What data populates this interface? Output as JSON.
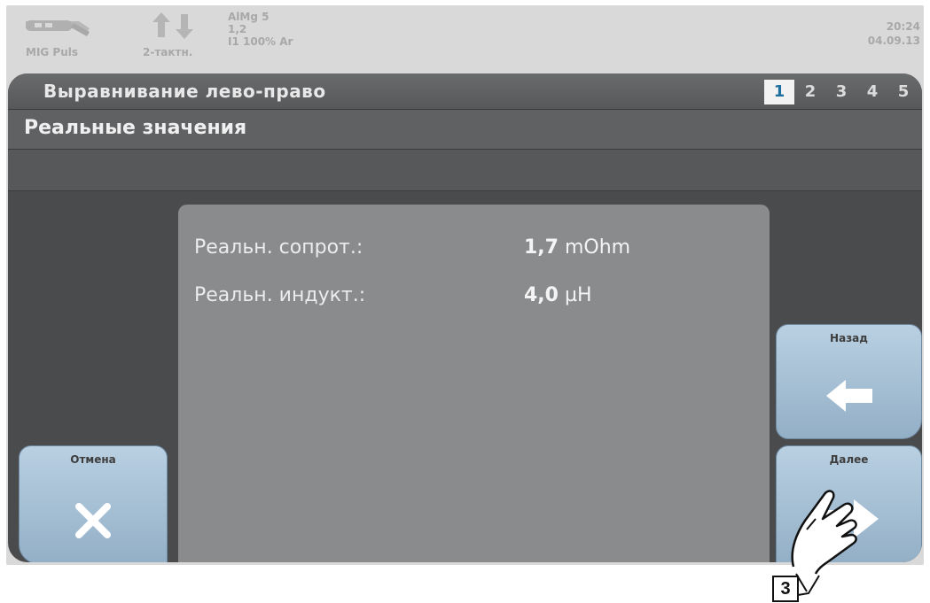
{
  "status_bar": {
    "mode_label": "MIG Puls",
    "trigger_label": "2-тактн.",
    "material_lines": [
      "AlMg 5",
      "1,2",
      "I1 100% Ar"
    ],
    "time": "20:24",
    "date": "04.09.13"
  },
  "window": {
    "title": "Выравнивание лево-право",
    "pages": [
      "1",
      "2",
      "3",
      "4",
      "5"
    ],
    "active_page": "1",
    "subheader": "Реальные значения"
  },
  "values": [
    {
      "label": "Реальн. сопрот.:",
      "number": "1,7",
      "unit": "mOhm"
    },
    {
      "label": "Реальн. индукт.:",
      "number": "4,0",
      "unit": "µH"
    }
  ],
  "buttons": {
    "cancel": {
      "label": "Отмена",
      "icon": "close-icon"
    },
    "back": {
      "label": "Назад",
      "icon": "arrow-left-icon"
    },
    "next": {
      "label": "Далее",
      "icon": "arrow-right-icon"
    }
  },
  "callout": {
    "number": "3"
  },
  "colors": {
    "panel": "#4a4b4d",
    "content": "#8a8b8d",
    "button": "#a8c1d6",
    "active_page_text": "#1f6f9f"
  }
}
